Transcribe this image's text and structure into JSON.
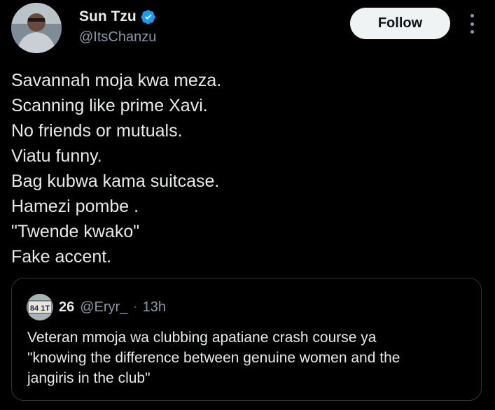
{
  "author": {
    "name": "Sun Tzu",
    "handle": "@ItsChanzu",
    "verified": true,
    "avatar_icon": "profile-photo"
  },
  "follow_label": "Follow",
  "tweet": {
    "lines": [
      "Savannah moja kwa meza.",
      "Scanning like prime Xavi.",
      "No friends or mutuals.",
      "Viatu funny.",
      "Bag kubwa kama suitcase.",
      "Hamezi pombe .",
      "\"Twende kwako\"",
      "Fake accent."
    ]
  },
  "quote": {
    "name": "26",
    "handle": "@Eryr_",
    "separator": "·",
    "time": "13h",
    "avatar_text": "84 1T",
    "lines": [
      "Veteran mmoja wa clubbing apatiane crash course ya",
      "\"knowing the difference between genuine women and the",
      "jangiris in the club\""
    ]
  },
  "colors": {
    "background": "#000000",
    "text": "#e7e9ea",
    "muted": "#8b98a5",
    "verified": "#1d9bf0",
    "border": "#2f3336",
    "follow_bg": "#eff3f4"
  }
}
